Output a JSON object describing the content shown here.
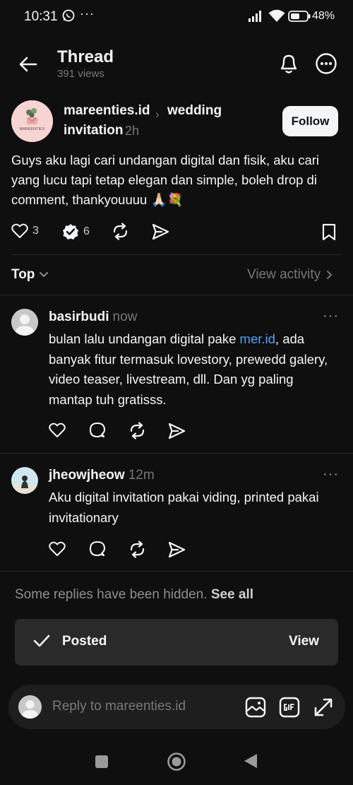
{
  "status_bar": {
    "time": "10:31",
    "more": "···",
    "battery": "48%"
  },
  "header": {
    "title": "Thread",
    "views": "391 views"
  },
  "post": {
    "author": "mareenties.id",
    "logo_text": "MAREENTIES",
    "separator": "›",
    "topic_line1": "wedding",
    "topic_line2": "invitation",
    "time": "2h",
    "follow_label": "Follow",
    "text": "Guys aku lagi cari undangan digital dan fisik, aku cari yang lucu tapi tetap elegan dan simple, boleh drop di comment, thankyouuuu 🙏🏻💐",
    "likes": "3",
    "replies": "6"
  },
  "sort": {
    "label": "Top",
    "view_activity": "View activity"
  },
  "replies": [
    {
      "user": "basirbudi",
      "time": "now",
      "text_before": "bulan lalu undangan digital pake ",
      "link": "mer.id",
      "text_after": ", ada banyak fitur termasuk lovestory, prewedd galery, video teaser, livestream, dll. Dan yg paling mantap tuh gratisss.",
      "more": "···"
    },
    {
      "user": "jheowjheow",
      "time": "12m",
      "text": "Aku digital invitation pakai viding, printed pakai invitationary",
      "more": "···"
    }
  ],
  "hidden_note": {
    "text": "Some replies have been hidden.",
    "see_all": "See all"
  },
  "toast": {
    "label": "Posted",
    "action": "View"
  },
  "reply_bar": {
    "placeholder": "Reply to mareenties.id"
  },
  "colors": {
    "background": "#0f0f0f",
    "link": "#4aa3ff",
    "muted": "#777777"
  }
}
